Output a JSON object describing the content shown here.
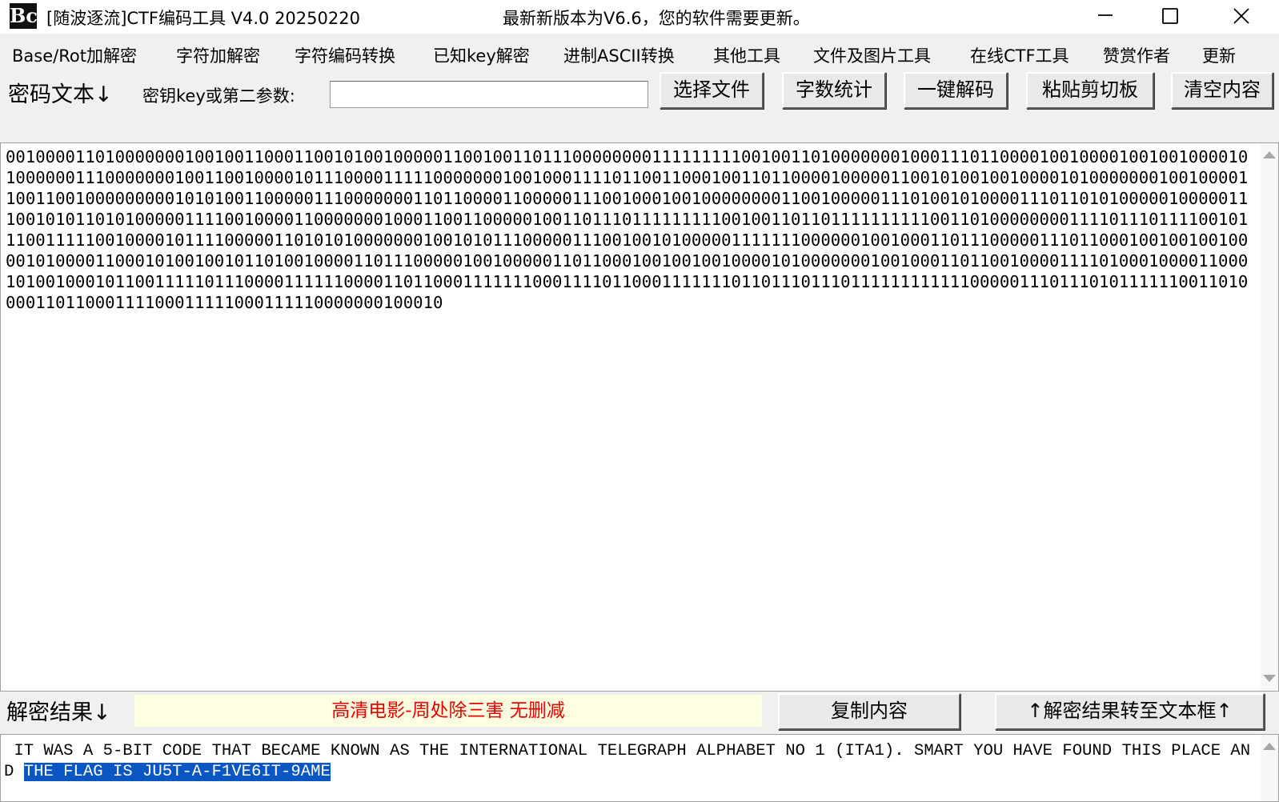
{
  "window": {
    "app_icon_text": "Bc",
    "title": "[随波逐流]CTF编码工具 V4.0 20250220",
    "update_notice": "最新新版本为V6.6，您的软件需要更新。"
  },
  "menu": [
    "Base/Rot加解密",
    "字符加解密",
    "字符编码转换",
    "已知key解密",
    "进制ASCII转换",
    "其他工具",
    "文件及图片工具",
    "在线CTF工具",
    "赞赏作者",
    "更新"
  ],
  "toolbar": {
    "cipher_label": "密码文本↓",
    "key_label": "密钥key或第二参数:",
    "key_value": "",
    "select_file": "选择文件",
    "word_count": "字数统计",
    "one_click_decode": "一键解码",
    "paste_clipboard": "粘贴剪切板",
    "clear_content": "清空内容"
  },
  "cipher": {
    "text": "0010000110100000001001001100011001010010000011001001101110000000011111111100100110100000001000111011000010010000100100100001010000001110000000100110010000101110000111110000000100100011110110011000100110110000100000110010100100100001010000000100100001100110010000000001010100110000011100000001101100001100000111001000100100000000110010000011101001010000111011010100000100000111001010110101000001111001000011000000010001100110000010011011101111111110010011011011111111110011010000000011110111011110010111001111100100001011110000011010101000000010010101110000011100100101000001111111000000100100011011100000111011000100100100100001010000110001010010010110100100001101110000010010000011011000100100100100001010000000100100011011001000011110100010000110001010010001011001111101110000111111000011011000111111100011110110001111111011011101110111111111111000001110111010111111001101000011011000111100011111000111110000000100010"
  },
  "result": {
    "label": "解密结果↓",
    "banner": "高清电影-周处除三害 无删减",
    "copy_button": "复制内容",
    "transfer_button": "↑解密结果转至文本框↑",
    "text_before": " IT WAS A 5-BIT CODE THAT BECAME KNOWN AS THE INTERNATIONAL TELEGRAPH ALPHABET NO 1 (ITA1). SMART YOU HAVE FOUND THIS PLACE AND ",
    "text_selected": "THE FLAG IS JU5T-A-F1VE6IT-9AME"
  },
  "colors": {
    "selection": "#0a56c2",
    "banner_background": "#ffffe1",
    "banner_text": "#e60000"
  }
}
